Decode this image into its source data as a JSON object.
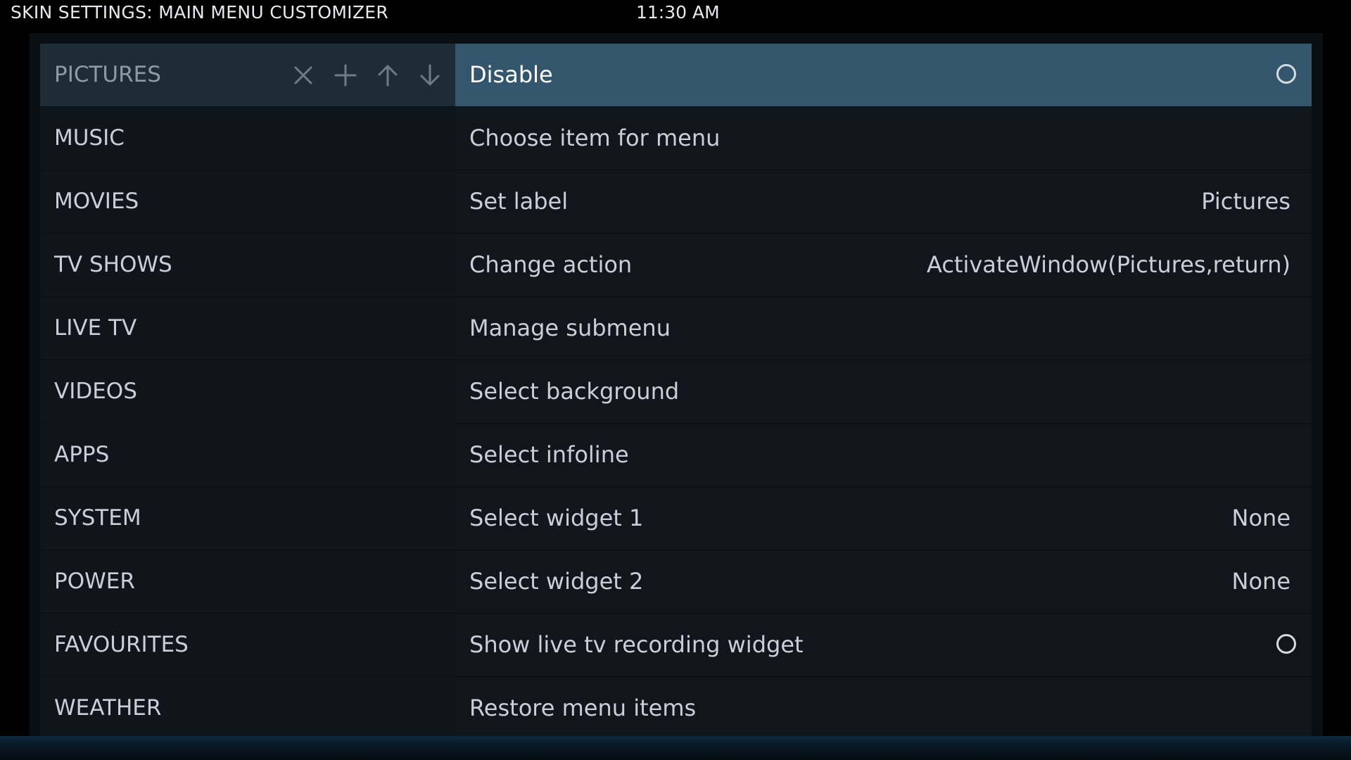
{
  "header": {
    "title": "SKIN SETTINGS: MAIN MENU CUSTOMIZER",
    "clock": "11:30 AM"
  },
  "menu_items": [
    {
      "label": "PICTURES",
      "selected": true
    },
    {
      "label": "MUSIC"
    },
    {
      "label": "MOVIES"
    },
    {
      "label": "TV SHOWS"
    },
    {
      "label": "LIVE TV"
    },
    {
      "label": "VIDEOS"
    },
    {
      "label": "APPS"
    },
    {
      "label": "SYSTEM"
    },
    {
      "label": "POWER"
    },
    {
      "label": "FAVOURITES"
    },
    {
      "label": "WEATHER"
    }
  ],
  "toolbar": {
    "icons": [
      "close-icon",
      "plus-icon",
      "arrow-up-icon",
      "arrow-down-icon"
    ]
  },
  "options": [
    {
      "label": "Disable",
      "toggle": false,
      "focused": true
    },
    {
      "label": "Choose item for menu"
    },
    {
      "label": "Set label",
      "value": "Pictures"
    },
    {
      "label": "Change action",
      "value": "ActivateWindow(Pictures,return)"
    },
    {
      "label": "Manage submenu"
    },
    {
      "label": "Select background"
    },
    {
      "label": "Select infoline"
    },
    {
      "label": "Select widget 1",
      "value": "None"
    },
    {
      "label": "Select widget 2",
      "value": "None"
    },
    {
      "label": "Show live tv recording widget",
      "toggle": false
    },
    {
      "label": "Restore menu items"
    }
  ],
  "colors": {
    "focus_row": "#33566d",
    "selected_item": "#1e2c38",
    "panel": "#0a0f14",
    "text": "#c9cfd6"
  }
}
